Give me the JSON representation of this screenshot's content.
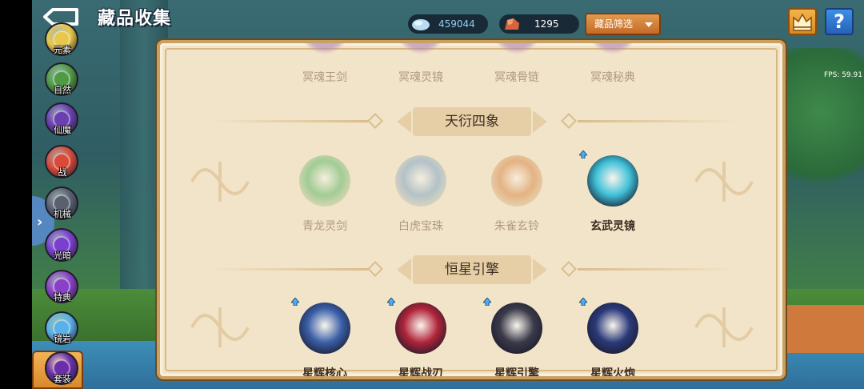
{
  "header": {
    "title": "藏品收集",
    "gem_count": "459044",
    "ore_count": "1295",
    "filter_label": "藏品筛选",
    "help_label": "?",
    "fps": "FPS: 59.91"
  },
  "sidebar": {
    "items": [
      {
        "label": "元素",
        "color": "#e8c84a"
      },
      {
        "label": "自然",
        "color": "#4f9b43"
      },
      {
        "label": "仙魔",
        "color": "#6a3fb0"
      },
      {
        "label": "战",
        "color": "#d94a3a"
      },
      {
        "label": "机械",
        "color": "#5a6070"
      },
      {
        "label": "光暗",
        "color": "#7a3fd0"
      },
      {
        "label": "特典",
        "color": "#8a3fc8"
      },
      {
        "label": "镜岩",
        "color": "#5ab0e8"
      },
      {
        "label": "套装",
        "color": "#6a2fa8"
      }
    ],
    "active_index": 8
  },
  "panel": {
    "top_row": [
      "冥魂王剑",
      "冥魂灵镜",
      "冥魂骨链",
      "冥魂秘典"
    ],
    "sections": [
      {
        "title": "天衍四象",
        "items": [
          {
            "label": "青龙灵剑",
            "owned": false,
            "color": "#5fb86a"
          },
          {
            "label": "白虎宝珠",
            "owned": false,
            "color": "#7fa6c8"
          },
          {
            "label": "朱雀玄铃",
            "owned": false,
            "color": "#d98a4a"
          },
          {
            "label": "玄武灵镜",
            "owned": true,
            "color": "#3fc0d8"
          }
        ]
      },
      {
        "title": "恒星引擎",
        "items": [
          {
            "label": "星辉核心",
            "owned": true,
            "color": "#3a5fa8"
          },
          {
            "label": "星辉战刃",
            "owned": true,
            "color": "#b0243a"
          },
          {
            "label": "星辉引擎",
            "owned": true,
            "color": "#3a3a4a"
          },
          {
            "label": "星辉火炮",
            "owned": true,
            "color": "#2a3a7a"
          }
        ]
      }
    ]
  }
}
